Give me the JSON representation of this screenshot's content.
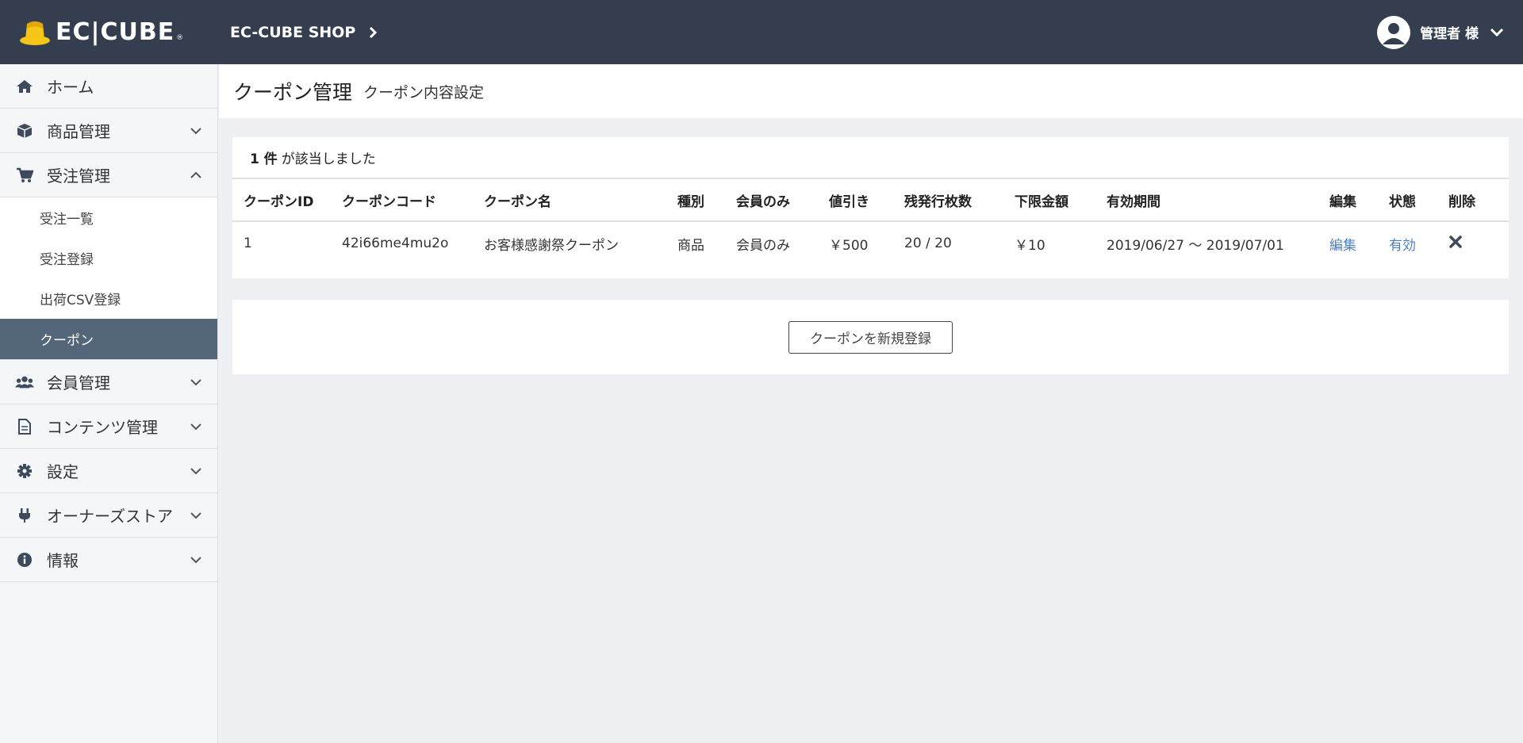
{
  "header": {
    "logo_text": "EC|CUBE",
    "logo_reg": "®",
    "shop_name": "EC-CUBE SHOP",
    "user_label": "管理者 様"
  },
  "sidebar": {
    "items": [
      {
        "label": "ホーム",
        "icon": "home-icon"
      },
      {
        "label": "商品管理",
        "icon": "cube-icon"
      },
      {
        "label": "受注管理",
        "icon": "cart-icon"
      },
      {
        "label": "会員管理",
        "icon": "users-icon"
      },
      {
        "label": "コンテンツ管理",
        "icon": "file-icon"
      },
      {
        "label": "設定",
        "icon": "gear-icon"
      },
      {
        "label": "オーナーズストア",
        "icon": "plug-icon"
      },
      {
        "label": "情報",
        "icon": "info-icon"
      }
    ],
    "sub_items": [
      {
        "label": "受注一覧"
      },
      {
        "label": "受注登録"
      },
      {
        "label": "出荷CSV登録"
      },
      {
        "label": "クーポン",
        "active": true
      }
    ]
  },
  "page": {
    "title": "クーポン管理",
    "subtitle": "クーポン内容設定"
  },
  "results": {
    "count": "1 件",
    "count_suffix": "が該当しました",
    "columns": [
      "クーポンID",
      "クーポンコード",
      "クーポン名",
      "種別",
      "会員のみ",
      "値引き",
      "残発行枚数",
      "下限金額",
      "有効期間",
      "編集",
      "状態",
      "削除"
    ],
    "rows": [
      {
        "id": "1",
        "code": "42i66me4mu2o",
        "name": "お客様感謝祭クーポン",
        "type": "商品",
        "member_only": "会員のみ",
        "discount": "￥500",
        "remaining": "20 / 20",
        "min_amount": "￥10",
        "period": "2019/06/27 ～ 2019/07/01",
        "edit": "編集",
        "status": "有効"
      }
    ]
  },
  "actions": {
    "new_button": "クーポンを新規登録"
  },
  "colors": {
    "header_bg": "#343e4f",
    "logo_yellow": "#f5c518",
    "active_bg": "#54667a",
    "link": "#4a80c2"
  }
}
